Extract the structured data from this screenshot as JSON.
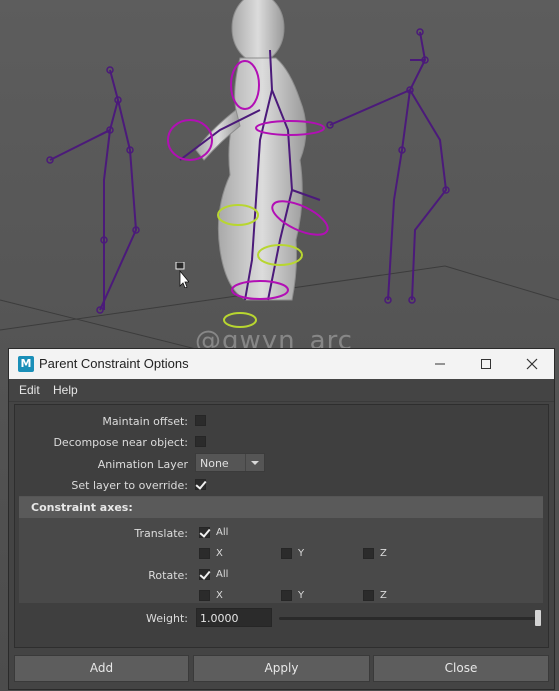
{
  "viewport": {
    "watermark": "@gwyn_arc"
  },
  "window": {
    "app_icon_letter": "M",
    "title": "Parent Constraint Options",
    "controls": {
      "minimize_icon": "minimize-icon",
      "maximize_icon": "maximize-icon",
      "close_icon": "close-icon"
    }
  },
  "menu": {
    "edit": "Edit",
    "help": "Help"
  },
  "options": {
    "maintain_offset_label": "Maintain offset:",
    "maintain_offset_checked": false,
    "decompose_label": "Decompose near object:",
    "decompose_checked": false,
    "animation_layer_label": "Animation Layer",
    "animation_layer_value": "None",
    "set_layer_label": "Set layer to override:",
    "set_layer_checked": true
  },
  "constraint_axes": {
    "title": "Constraint axes:",
    "translate": {
      "label": "Translate:",
      "all_label": "All",
      "all_checked": true,
      "x": "X",
      "y": "Y",
      "z": "Z"
    },
    "rotate": {
      "label": "Rotate:",
      "all_label": "All",
      "all_checked": true,
      "x": "X",
      "y": "Y",
      "z": "Z"
    }
  },
  "weight": {
    "label": "Weight:",
    "value": "1.0000",
    "slider_fraction": 1.0
  },
  "buttons": {
    "add": "Add",
    "apply": "Apply",
    "close": "Close"
  },
  "colors": {
    "skeleton": "#4b1a7a",
    "control_curve": "#b20fb5",
    "foot_control": "#b8d630",
    "dialog_bg": "#444444",
    "titlebar_bg": "#f3f3f3"
  }
}
